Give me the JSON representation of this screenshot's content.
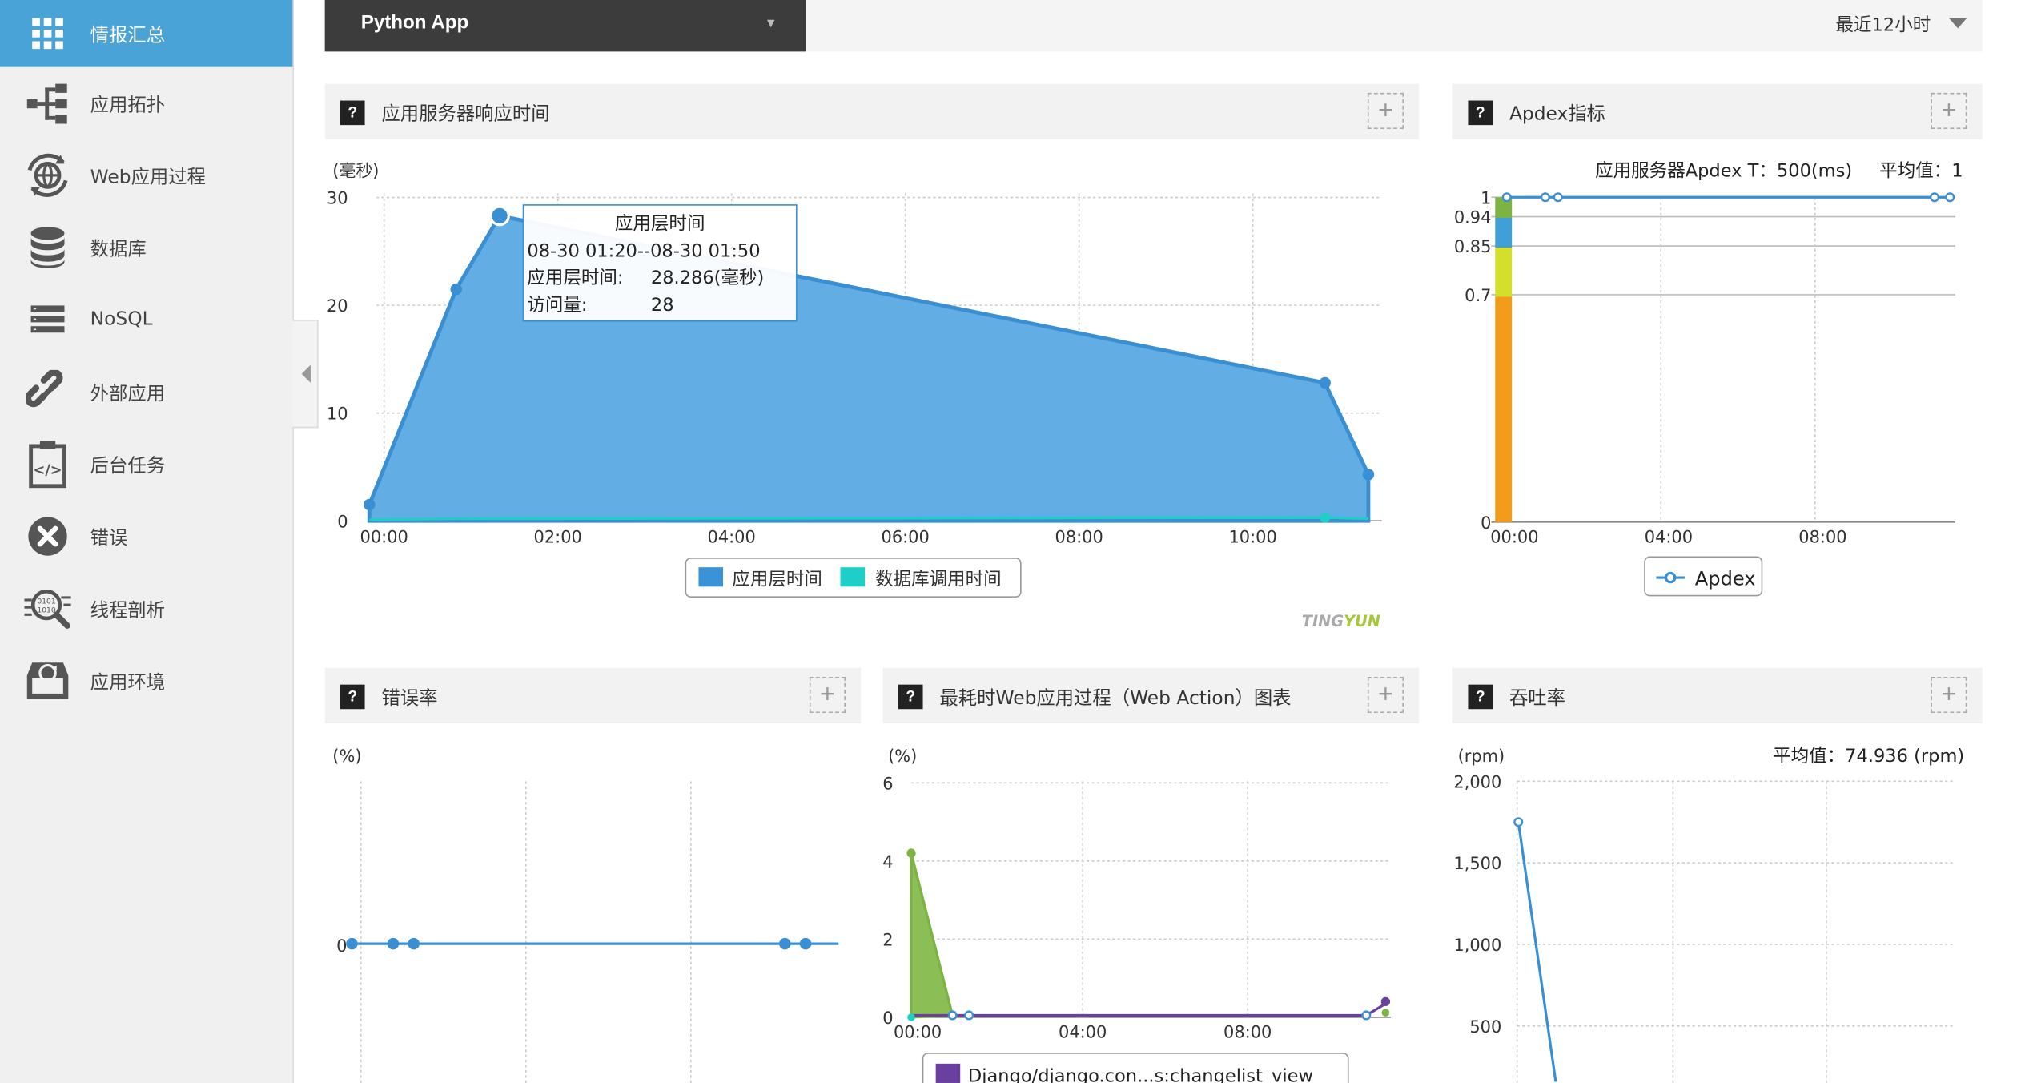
{
  "sidebar": {
    "items": [
      {
        "label": "情报汇总",
        "icon": "grid-icon"
      },
      {
        "label": "应用拓扑",
        "icon": "topology-icon"
      },
      {
        "label": "Web应用过程",
        "icon": "globe-cycle-icon"
      },
      {
        "label": "数据库",
        "icon": "database-icon"
      },
      {
        "label": "NoSQL",
        "icon": "nosql-icon"
      },
      {
        "label": "外部应用",
        "icon": "link-icon"
      },
      {
        "label": "后台任务",
        "icon": "code-task-icon"
      },
      {
        "label": "错误",
        "icon": "error-x-icon"
      },
      {
        "label": "线程剖析",
        "icon": "thread-magnifier-icon"
      },
      {
        "label": "应用环境",
        "icon": "environment-icon"
      }
    ]
  },
  "topbar": {
    "app_name": "Python App",
    "time_range": "最近12小时"
  },
  "panels": {
    "response": {
      "title": "应用服务器响应时间",
      "unit": "(毫秒)",
      "watermark_a": "TING",
      "watermark_b": "YUN",
      "tooltip": {
        "title": "应用层时间",
        "range": "08-30 01:20--08-30 01:50",
        "row1_label": "应用层时间:",
        "row1_value": "28.286(毫秒)",
        "row2_label": "访问量:",
        "row2_value": "28"
      }
    },
    "apdex": {
      "title": "Apdex指标",
      "subtitle": "应用服务器Apdex T：500(ms)",
      "avg": "平均值：1"
    },
    "error": {
      "title": "错误率",
      "unit": "(%)"
    },
    "webaction": {
      "title": "最耗时Web应用过程（Web Action）图表",
      "unit": "(%)",
      "legend_partial": "Django/django.con...s:changelist_view"
    },
    "throughput": {
      "title": "吞吐率",
      "unit": "(rpm)",
      "avg": "平均值：74.936 (rpm)"
    }
  },
  "colors": {
    "accent": "#4aa3d6",
    "app_layer": "#3a93d6",
    "db_time": "#1ecfc8",
    "apdex_green": "#7cb342",
    "apdex_blue": "#3f9fd6",
    "apdex_yellow": "#d4df2a",
    "apdex_orange": "#f39c1a",
    "web_green": "#7cb342",
    "web_purple": "#6a3fa0"
  },
  "chart_data": [
    {
      "type": "area",
      "title": "",
      "ylabel": "(毫秒)",
      "ylim": [
        0,
        30
      ],
      "yticks": [
        "0",
        "10",
        "20",
        "30"
      ],
      "xticks": [
        "00:00",
        "02:00",
        "04:00",
        "06:00",
        "08:00",
        "10:00"
      ],
      "x_hours": [
        -0.17,
        0.83,
        1.33,
        10.83,
        11.33
      ],
      "series": [
        {
          "name": "应用层时间",
          "values": [
            1.5,
            21.5,
            28.3,
            12.8,
            4.3
          ]
        },
        {
          "name": "数据库调用时间",
          "values": [
            0.1,
            0.2,
            0.2,
            0.3,
            0.2
          ]
        }
      ]
    },
    {
      "type": "line",
      "title": "",
      "yticks": [
        "0",
        "0.7",
        "0.85",
        "0.94",
        "1"
      ],
      "xticks": [
        "00:00",
        "04:00",
        "08:00"
      ],
      "ylim": [
        0,
        1
      ],
      "x_hours": [
        0,
        1,
        1.33,
        11.1,
        11.5
      ],
      "series": [
        {
          "name": "Apdex",
          "values": [
            1,
            1,
            1,
            1,
            1
          ]
        }
      ]
    },
    {
      "type": "line",
      "title": "",
      "ylabel": "(%)",
      "yticks": [
        "0"
      ],
      "x_hours": [
        0,
        1,
        1.5,
        10.5,
        11
      ],
      "series": [
        {
          "name": "",
          "values": [
            0,
            0,
            0,
            0,
            0
          ]
        }
      ]
    },
    {
      "type": "area",
      "title": "",
      "ylabel": "(%)",
      "ylim": [
        0,
        6
      ],
      "yticks": [
        "0",
        "2",
        "4",
        "6"
      ],
      "xticks": [
        "00:00",
        "04:00",
        "08:00"
      ],
      "x_hours": [
        0,
        1,
        1.33,
        11.1,
        11.5
      ],
      "series": [
        {
          "name": "",
          "values": [
            4.2,
            0.05,
            0.05,
            0.05,
            0.1
          ]
        },
        {
          "name": "Django/django.con...s:changelist_view",
          "values": [
            0,
            0,
            0,
            0,
            0.4
          ]
        }
      ]
    },
    {
      "type": "line",
      "title": "",
      "ylabel": "(rpm)",
      "yticks": [
        "500",
        "1,000",
        "1,500",
        "2,000"
      ],
      "ylim": [
        0,
        2000
      ],
      "x_hours": [
        0,
        1
      ],
      "series": [
        {
          "name": "",
          "values": [
            1750,
            0
          ]
        }
      ]
    }
  ]
}
